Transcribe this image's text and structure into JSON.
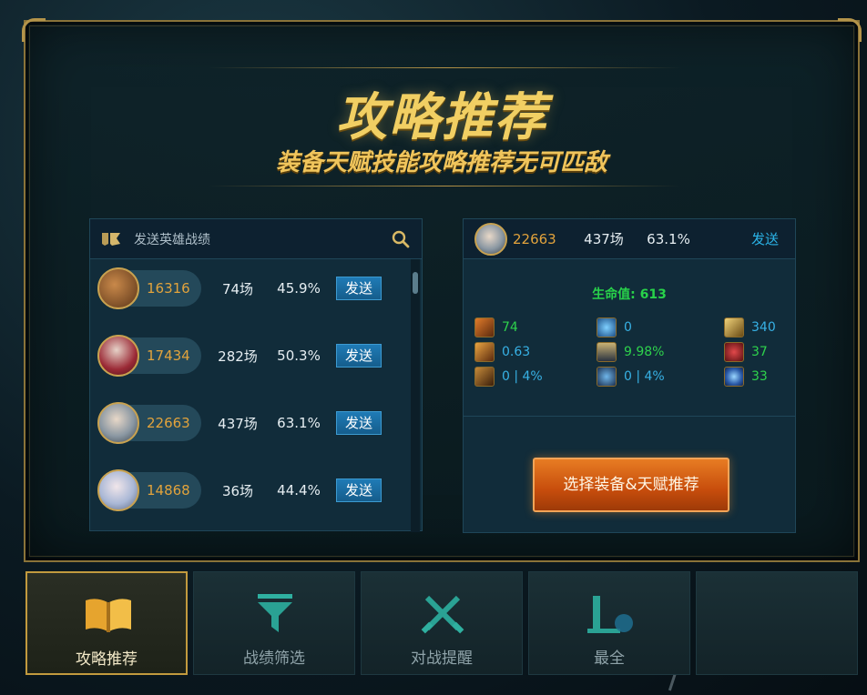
{
  "hero": {
    "title": "攻略推荐",
    "subtitle": "装备天赋技能攻略推荐无可匹敌"
  },
  "left_panel": {
    "title": "发送英雄战绩",
    "logo_icon": "lol-logo-icon",
    "search_icon": "search-icon",
    "rows": [
      {
        "id": "16316",
        "games": "74场",
        "rate": "45.9%",
        "button": "发送",
        "avatar_color": "#8a5a2e"
      },
      {
        "id": "17434",
        "games": "282场",
        "rate": "50.3%",
        "button": "发送",
        "avatar_color": "#9b2a36"
      },
      {
        "id": "22663",
        "games": "437场",
        "rate": "63.1%",
        "button": "发送",
        "avatar_color": "#7a8a95"
      },
      {
        "id": "14868",
        "games": "36场",
        "rate": "44.4%",
        "button": "发送",
        "avatar_color": "#a9b7d4"
      }
    ]
  },
  "right_panel": {
    "header": {
      "id": "22663",
      "games": "437场",
      "rate": "63.1%",
      "send": "发送"
    },
    "hp": "生命值: 613",
    "stats": [
      {
        "icon": "attack-damage-icon",
        "value": "74",
        "color": "green"
      },
      {
        "icon": "ability-power-icon",
        "value": "0",
        "color": "blue"
      },
      {
        "icon": "mana-icon",
        "value": "340",
        "color": "blue"
      },
      {
        "icon": "attack-speed-icon",
        "value": "0.63",
        "color": "blue"
      },
      {
        "icon": "cooldown-icon",
        "value": "9.98%",
        "color": "green"
      },
      {
        "icon": "armor-icon",
        "value": "37",
        "color": "green"
      },
      {
        "icon": "armor-pen-icon",
        "value": "0 | 4%",
        "color": "blue"
      },
      {
        "icon": "magic-pen-icon",
        "value": "0 | 4%",
        "color": "blue"
      },
      {
        "icon": "magic-resist-icon",
        "value": "33",
        "color": "green"
      }
    ],
    "choose_button": "选择装备&天赋推荐"
  },
  "tabs": [
    {
      "label": "攻略推荐",
      "icon": "book-icon",
      "active": true
    },
    {
      "label": "战绩筛选",
      "icon": "filter-icon",
      "active": false
    },
    {
      "label": "对战提醒",
      "icon": "crossed-swords-icon",
      "active": false
    },
    {
      "label": "最全",
      "icon": "chart-icon",
      "active": false
    },
    {
      "label": "",
      "icon": "",
      "active": false
    }
  ],
  "colors": {
    "gold": "#f1cf63",
    "accent_orange": "#e2a33c",
    "green": "#2ed24c",
    "blue": "#37b1e5",
    "button_blue": "#1f7bb6"
  }
}
